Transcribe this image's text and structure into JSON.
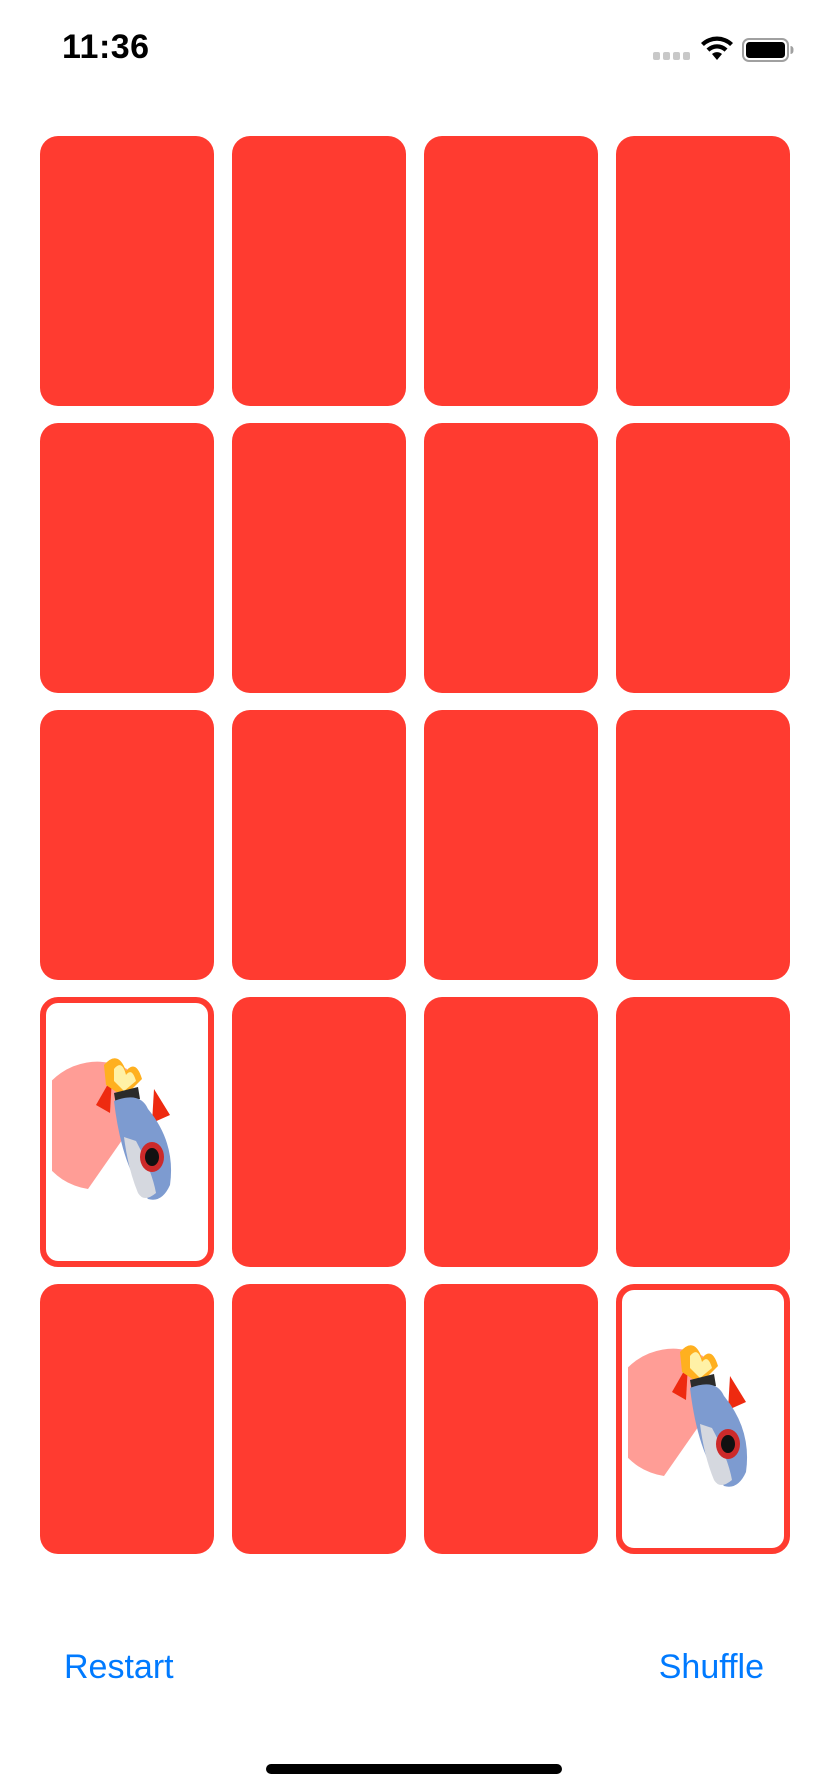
{
  "status_bar": {
    "time": "11:36",
    "icons": [
      "cellular-signal-icon",
      "wifi-icon",
      "battery-icon"
    ]
  },
  "colors": {
    "card_back": "#ff3b30",
    "card_face": "#ffffff",
    "accent": "#007aff"
  },
  "board": {
    "columns": 4,
    "rows": 5,
    "cards": [
      {
        "face_up": false
      },
      {
        "face_up": false
      },
      {
        "face_up": false
      },
      {
        "face_up": false
      },
      {
        "face_up": false
      },
      {
        "face_up": false
      },
      {
        "face_up": false
      },
      {
        "face_up": false
      },
      {
        "face_up": false
      },
      {
        "face_up": false
      },
      {
        "face_up": false
      },
      {
        "face_up": false
      },
      {
        "face_up": true,
        "content": "rocket-icon"
      },
      {
        "face_up": false
      },
      {
        "face_up": false
      },
      {
        "face_up": false
      },
      {
        "face_up": false
      },
      {
        "face_up": false
      },
      {
        "face_up": false
      },
      {
        "face_up": true,
        "content": "rocket-icon"
      }
    ]
  },
  "toolbar": {
    "restart_label": "Restart",
    "shuffle_label": "Shuffle"
  }
}
